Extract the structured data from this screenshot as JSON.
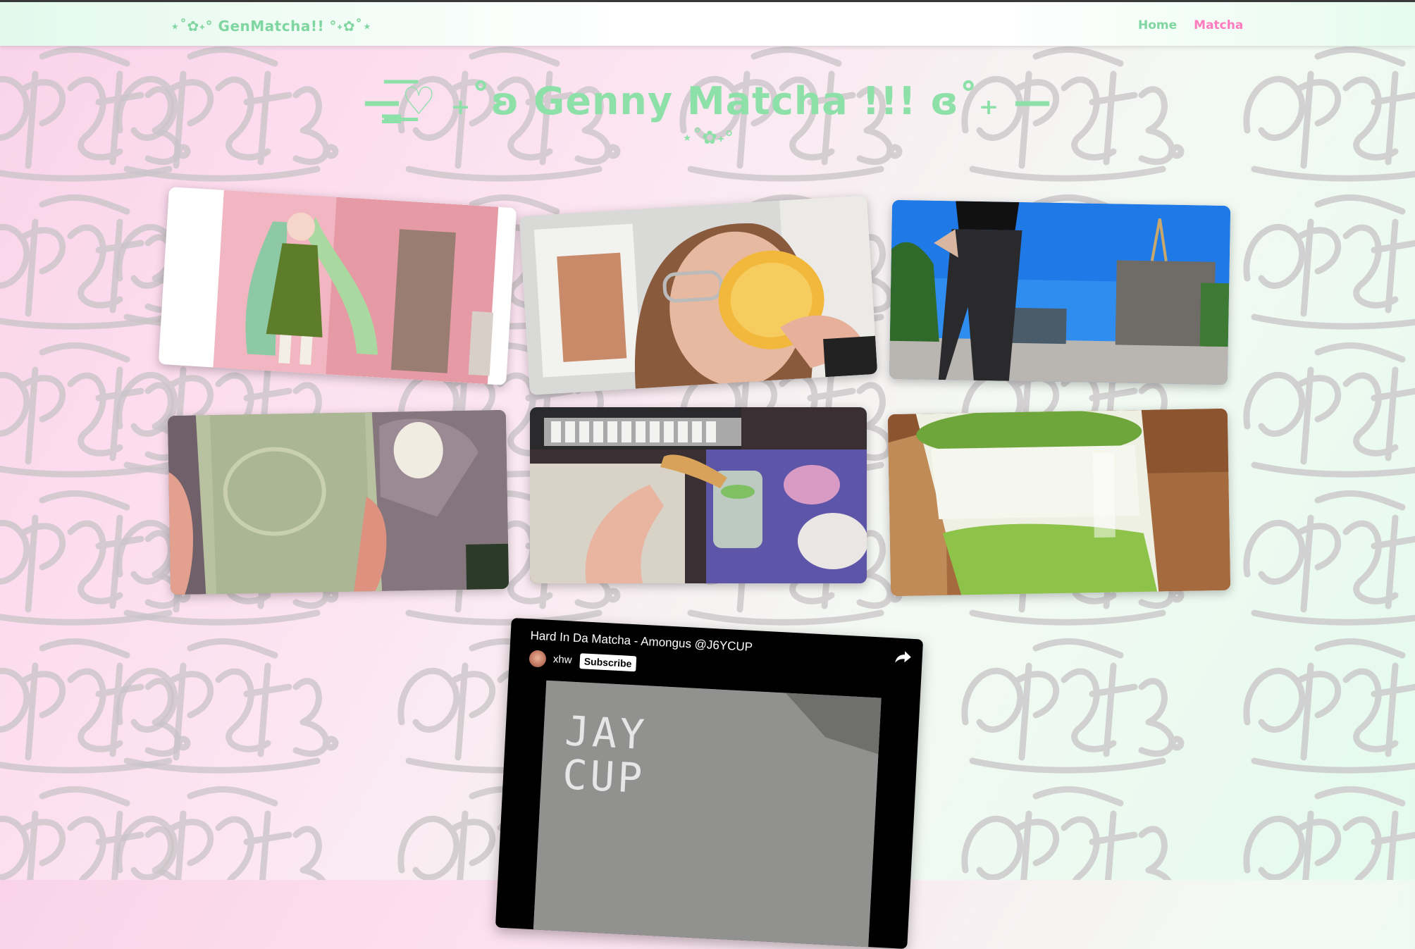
{
  "navbar": {
    "brand": "⋆˚✿˖° GenMatcha!! °˖✿˚⋆",
    "links": [
      {
        "label": "Home",
        "color": "#7fd6a0"
      },
      {
        "label": "Matcha",
        "color": "#ff79bd"
      }
    ]
  },
  "header": {
    "title": "—̳͟͞͞♡ ₊˚ʚ Genny Matcha !!! ɞ˚₊ —",
    "subtitle": "⋆˚✿˖°"
  },
  "colors": {
    "accent_green": "#8ee0a9",
    "accent_pink": "#ff79bd",
    "bg_pink": "#fad3ea",
    "bg_mint": "#e4fbee"
  },
  "gallery": [
    {
      "name": "photo-miku-figure"
    },
    {
      "name": "photo-drinking-cup"
    },
    {
      "name": "photo-skatepark"
    },
    {
      "name": "photo-matcha-bottle"
    },
    {
      "name": "photo-biscotti-keyboard"
    },
    {
      "name": "photo-matcha-jar"
    }
  ],
  "video": {
    "title": "Hard In Da Matcha - Amongus @J6YCUP",
    "channel": "xhw",
    "subscribe_label": "Subscribe",
    "frame_text": [
      "JAY",
      "CUP"
    ]
  }
}
